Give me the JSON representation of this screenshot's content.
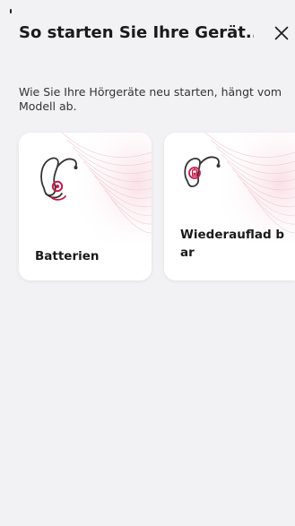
{
  "header": {
    "title": "So starten Sie Ihre Gerät...",
    "close_icon": "close-icon"
  },
  "intro": {
    "text": "Wie Sie Ihre Hörgeräte neu starten, hängt vom Modell ab."
  },
  "options": [
    {
      "label": "Batterien",
      "icon": "battery-hearing-aid-icon"
    },
    {
      "label": "Wiederauflad bar",
      "icon": "rechargeable-hearing-aid-icon"
    }
  ],
  "colors": {
    "background": "#f2f2f5",
    "card": "#ffffff",
    "accent": "#c8194b",
    "text": "#1a1a1a"
  }
}
